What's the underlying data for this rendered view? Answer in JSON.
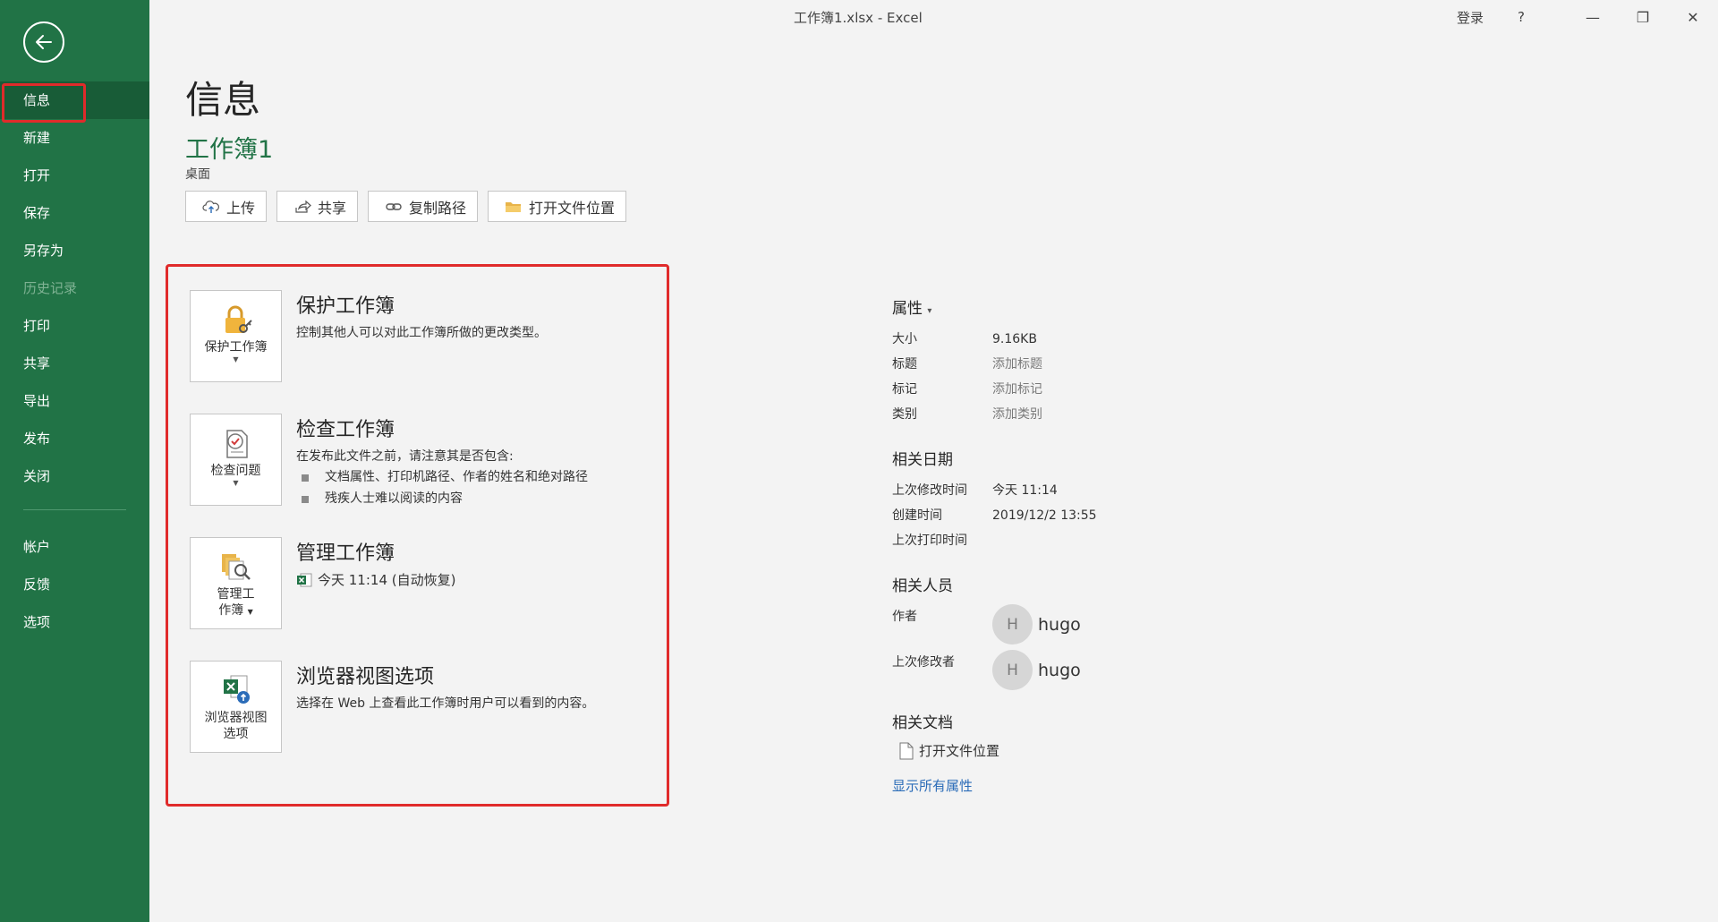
{
  "titlebar": {
    "title": "工作簿1.xlsx  -  Excel",
    "signin": "登录",
    "help": "?",
    "minimize": "—",
    "restore": "❐",
    "close": "✕"
  },
  "sidebar": {
    "items": [
      {
        "label": "信息"
      },
      {
        "label": "新建"
      },
      {
        "label": "打开"
      },
      {
        "label": "保存"
      },
      {
        "label": "另存为"
      },
      {
        "label": "历史记录"
      },
      {
        "label": "打印"
      },
      {
        "label": "共享"
      },
      {
        "label": "导出"
      },
      {
        "label": "发布"
      },
      {
        "label": "关闭"
      }
    ],
    "bottom": [
      {
        "label": "帐户"
      },
      {
        "label": "反馈"
      },
      {
        "label": "选项"
      }
    ]
  },
  "main": {
    "title": "信息",
    "workbook_name": "工作簿1",
    "location": "桌面",
    "actions": {
      "upload": "上传",
      "share": "共享",
      "copy_path": "复制路径",
      "open_location": "打开文件位置"
    },
    "sections": {
      "protect": {
        "tile_label": "保护工作簿",
        "title": "保护工作簿",
        "desc": "控制其他人可以对此工作簿所做的更改类型。"
      },
      "inspect": {
        "tile_label": "检查问题",
        "title": "检查工作簿",
        "desc": "在发布此文件之前，请注意其是否包含:",
        "bullets": [
          "文档属性、打印机路径、作者的姓名和绝对路径",
          "残疾人士难以阅读的内容"
        ]
      },
      "manage": {
        "tile_label_1": "管理工",
        "tile_label_2": "作簿",
        "title": "管理工作簿",
        "recover": "今天 11:14 (自动恢复)"
      },
      "browser": {
        "tile_label_1": "浏览器视图",
        "tile_label_2": "选项",
        "title": "浏览器视图选项",
        "desc": "选择在 Web 上查看此工作簿时用户可以看到的内容。"
      }
    }
  },
  "properties": {
    "header": "属性",
    "caret": "▾",
    "rows": [
      {
        "k": "大小",
        "v": "9.16KB"
      },
      {
        "k": "标题",
        "v": "添加标题"
      },
      {
        "k": "标记",
        "v": "添加标记"
      },
      {
        "k": "类别",
        "v": "添加类别"
      }
    ],
    "dates_header": "相关日期",
    "dates": [
      {
        "k": "上次修改时间",
        "v": "今天 11:14"
      },
      {
        "k": "创建时间",
        "v": "2019/12/2 13:55"
      },
      {
        "k": "上次打印时间",
        "v": ""
      }
    ],
    "people_header": "相关人员",
    "author_label": "作者",
    "author_initial": "H",
    "author_name": "hugo",
    "modifier_label": "上次修改者",
    "modifier_initial": "H",
    "modifier_name": "hugo",
    "docs_header": "相关文档",
    "open_location": "打开文件位置",
    "show_all": "显示所有属性"
  }
}
